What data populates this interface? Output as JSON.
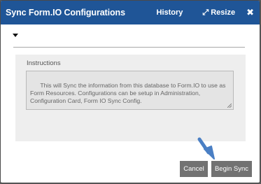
{
  "window": {
    "title": "Sync Form.IO Configurations",
    "history_label": "History",
    "resize_label": "Resize",
    "close_glyph": "✖"
  },
  "form": {
    "instructions_label": "Instructions",
    "instructions_text": "This will Sync the information from this database to Form.IO to use as Form Resources. Configurations can be setup in Administration, Configuration Card, Form IO Sync Config."
  },
  "actions": {
    "cancel_label": "Cancel",
    "begin_sync_label": "Begin Sync"
  },
  "colors": {
    "titlebar": "#1f5597",
    "button": "#727272",
    "pointer_arrow": "#4a7fc4"
  },
  "icons": {
    "resize": "resize-icon",
    "close": "close-icon",
    "collapse": "caret-down-icon",
    "pointer": "pointer-arrow-icon"
  }
}
